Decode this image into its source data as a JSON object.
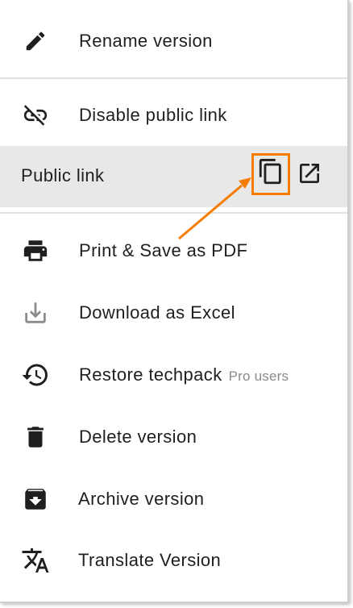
{
  "menu": {
    "items": [
      {
        "label": "Rename version",
        "icon": "pencil-icon"
      },
      {
        "label": "Disable public link",
        "icon": "link-off-icon"
      },
      {
        "label": "Print & Save as PDF",
        "icon": "printer-icon"
      },
      {
        "label": "Download as Excel",
        "icon": "download-icon"
      },
      {
        "label": "Restore techpack",
        "badge": "Pro users",
        "icon": "history-icon"
      },
      {
        "label": "Delete version",
        "icon": "trash-icon"
      },
      {
        "label": "Archive version",
        "icon": "archive-icon"
      },
      {
        "label": "Translate Version",
        "icon": "translate-icon"
      }
    ],
    "public_link": {
      "label": "Public link",
      "copy_icon": "copy-icon",
      "open_icon": "open-in-new-icon"
    }
  },
  "colors": {
    "highlight": "#f57c00",
    "row_background": "#e8e8e8",
    "text": "#1f1f1f",
    "badge_text": "#8a8a8a"
  }
}
